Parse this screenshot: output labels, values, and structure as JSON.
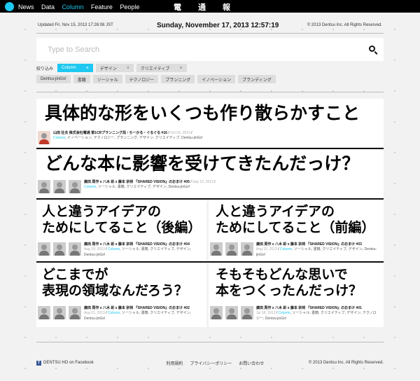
{
  "topbar": {
    "nav": [
      "News",
      "Data",
      "Column",
      "Feature",
      "People"
    ],
    "active": "Column",
    "brand": [
      "電",
      "通",
      "報"
    ]
  },
  "header": {
    "updated": "Updated Fri, Nov 15, 2013 17:26:08 JST",
    "clock": "Sunday, November 17, 2013 12:57:19",
    "copyright": "© 2013 Dentsu Inc. All Rights Reserved."
  },
  "search": {
    "placeholder": "Type to Search",
    "value": ""
  },
  "filters": {
    "label": "絞り込み",
    "selected": [
      "Column",
      "デザイン",
      "クリエイティブ"
    ],
    "options": [
      "Dentsu-jinGo!",
      "書籍",
      "ソーシャル",
      "テクノロジー",
      "プランニング",
      "イノベーション",
      "ブランディング"
    ]
  },
  "articles": [
    {
      "title": "具体的な形をいくつも作り散らかすこと",
      "author": "山田 壮夫 株式会社電通 第1CRプランニング局",
      "series": "ろーかる・ぐるぐる #16",
      "date": "Oct 03, 2013",
      "category": "Column",
      "tags": ", イノベーション, テクノロジー, プランニング, デザイン, クリエイティブ, Dentsu-jinGo!"
    },
    {
      "title": "どんな本に影響を受けてきたんだっけ？",
      "author": "廣田 周作 x 八木 彩 x 藤本 宗将 『SHARED VISION』のおまけ #05",
      "date": "Sep 12, 2013",
      "category": "Column",
      "tags": ", ソーシャル, 書籍, クリエイティブ, デザイン, Dentsu-jinGo!"
    },
    {
      "title_l1": "人と違うアイデアの",
      "title_l2": "ためにしてること（後編）",
      "author": "廣田 周作 x 八木 彩 x 藤本 宗将 『SHARED VISION』のおまけ #04",
      "date": "Aug 29, 2013",
      "category": "Column",
      "tags": ", ソーシャル, 書籍, クリエイティブ, デザイン, Dentsu-jinGo!"
    },
    {
      "title_l1": "人と違うアイデアの",
      "title_l2": "ためにしてること（前編）",
      "author": "廣田 周作 x 八木 彩 x 藤本 宗将 『SHARED VISION』のおまけ #03",
      "date": "Aug 15, 2013",
      "category": "Column",
      "tags": ", ソーシャル, 書籍, クリエイティブ, デザイン, Dentsu-jinGo!"
    },
    {
      "title_l1": "どこまでが",
      "title_l2": "表現の領域なんだろう？",
      "author": "廣田 周作 x 八木 彩 x 藤本 宗将 『SHARED VISION』のおまけ #02",
      "date": "Aug 01, 2013",
      "category": "Column",
      "tags": ", ソーシャル, 書籍, クリエイティブ, デザイン, Dentsu-jinGo!"
    },
    {
      "title_l1": "そもそもどんな思いで",
      "title_l2": "本をつくったんだっけ？",
      "author": "廣田 周作 x 八木 彩 x 藤本 宗将 『SHARED VISION』のおまけ #01",
      "date": "Jul 18, 2013",
      "category": "Column",
      "tags": ", ソーシャル, 書籍, クリエイティブ, デザイン, テクノロジー, Dentsu-jinGo!"
    }
  ],
  "footer": {
    "facebook": "DENTSU HO on Facebook",
    "links": [
      "利用規約",
      "プライバシーポリシー",
      "お問い合わせ"
    ],
    "copyright": "© 2013 Dentsu Inc. All Rights Reserved."
  }
}
